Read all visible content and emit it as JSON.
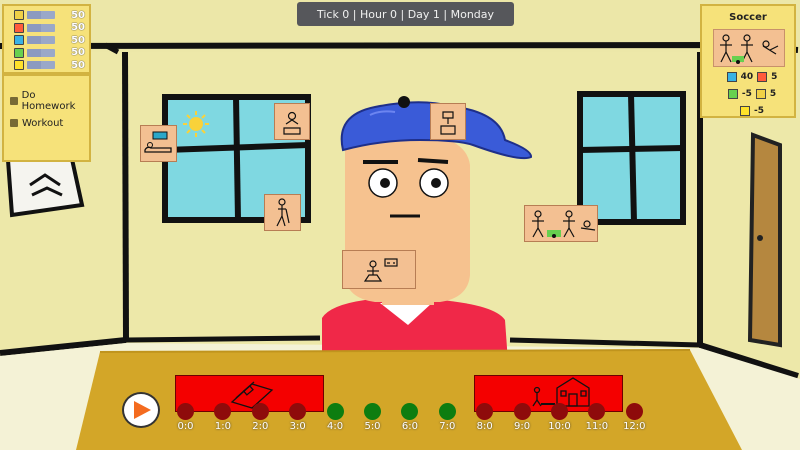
{
  "hud": {
    "status_text": "Tick 0 | Hour 0 | Day 1 | Monday"
  },
  "stats": [
    {
      "name": "happiness-icon",
      "value": "50",
      "color": "#f0d046",
      "level": 0.5
    },
    {
      "name": "food-icon",
      "value": "50",
      "color": "#ff5c3c",
      "level": 0.5
    },
    {
      "name": "study-icon",
      "value": "50",
      "color": "#39b2e5",
      "level": 0.5
    },
    {
      "name": "social-icon",
      "value": "50",
      "color": "#67d04f",
      "level": 0.5
    },
    {
      "name": "energy-icon",
      "value": "50",
      "color": "#ffe22a",
      "level": 0.5
    }
  ],
  "tasks": [
    {
      "label": "Do Homework"
    },
    {
      "label": "Workout"
    }
  ],
  "activity_panel": {
    "title": "Soccer",
    "effects": [
      {
        "icon": "study-icon",
        "icon_color": "#39b2e5",
        "value": "40"
      },
      {
        "icon": "food-icon",
        "icon_color": "#ff5c3c",
        "value": "5"
      },
      {
        "icon": "social-icon",
        "icon_color": "#67d04f",
        "value": "-5"
      },
      {
        "icon": "happiness-icon",
        "icon_color": "#f0d046",
        "value": "5"
      },
      {
        "icon": "energy-icon",
        "icon_color": "#ffe22a",
        "value": "-5"
      }
    ]
  },
  "timeline": {
    "hours": [
      "0:0",
      "1:0",
      "2:0",
      "3:0",
      "4:0",
      "5:0",
      "6:0",
      "7:0",
      "8:0",
      "9:0",
      "10:0",
      "11:0",
      "12:0"
    ],
    "slot_colors": [
      "#8e0b0b",
      "#8e0b0b",
      "#8e0b0b",
      "#8e0b0b",
      "#0d7d10",
      "#0d7d10",
      "#0d7d10",
      "#0d7d10",
      "#8e0b0b",
      "#8e0b0b",
      "#8e0b0b",
      "#8e0b0b",
      "#8e0b0b"
    ],
    "blocks": [
      {
        "name": "sleep-block",
        "icon": "bed-icon"
      },
      {
        "name": "school-block",
        "icon": "school-house-icon"
      }
    ]
  },
  "activity_cards": [
    {
      "name": "sunbathe-card",
      "icon": "sunbathe-icon"
    },
    {
      "name": "read-book-card",
      "icon": "read-book-icon"
    },
    {
      "name": "walk-card",
      "icon": "walk-icon"
    },
    {
      "name": "tv-card",
      "icon": "tv-icon"
    },
    {
      "name": "soccer-card",
      "icon": "soccer-icon"
    },
    {
      "name": "video-game-card",
      "icon": "video-game-icon"
    }
  ]
}
